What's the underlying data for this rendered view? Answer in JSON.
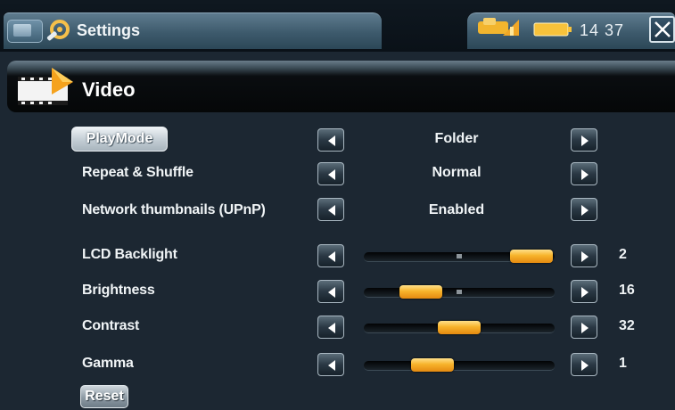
{
  "titlebar": {
    "title": "Settings",
    "clock": "14 37",
    "icons": {
      "menu": "menu-icon",
      "app": "settings-icon",
      "network": "network-icon",
      "battery": "battery-icon",
      "close": "close-icon"
    }
  },
  "section": {
    "title": "Video",
    "icon": "video-folder-icon"
  },
  "options": [
    {
      "label": "PlayMode",
      "value": "Folder"
    },
    {
      "label": "Repeat & Shuffle",
      "value": "Normal"
    },
    {
      "label": "Network thumbnails (UPnP)",
      "value": "Enabled"
    }
  ],
  "sliders": [
    {
      "label": "LCD Backlight",
      "value": "2",
      "level": 0.88
    },
    {
      "label": "Brightness",
      "value": "16",
      "level": 0.3
    },
    {
      "label": "Contrast",
      "value": "32",
      "level": 0.5
    },
    {
      "label": "Gamma",
      "value": "1",
      "level": 0.36
    }
  ],
  "reset_label": "Reset",
  "colors": {
    "accent": "#f7b32b",
    "background": "#1c2732",
    "title_bar": "#3d5a6c"
  }
}
